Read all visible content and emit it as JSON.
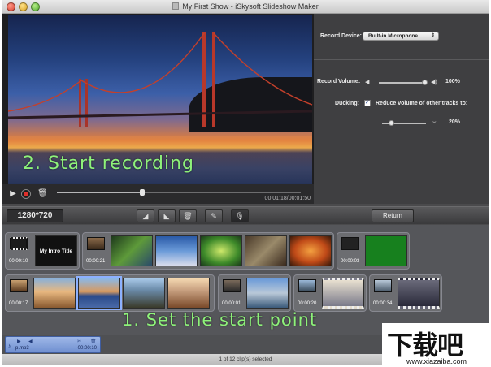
{
  "window": {
    "title": "My First Show - iSkysoft Slideshow Maker"
  },
  "preview": {
    "recording_hint": "2. Start recording",
    "timecode": "00:01:18/00:01:50",
    "playhead_fraction": 0.35
  },
  "panel": {
    "record_device_label": "Record Device:",
    "record_device_value": "Built-in Microphone",
    "record_volume_label": "Record Volume:",
    "record_volume_value": "100%",
    "record_volume_fraction": 1.0,
    "ducking_label": "Ducking:",
    "ducking_checked": true,
    "ducking_option": "Reduce volume of other tracks to:",
    "ducking_value": "20%",
    "ducking_fraction": 0.2
  },
  "toolbar": {
    "resolution": "1280*720",
    "return_label": "Return",
    "active_tool": "microphone-icon"
  },
  "storyboard": {
    "start_hint": "1. Set the start point",
    "groups": [
      {
        "lead_time": "00:00:10",
        "clips": [
          "My Intro Title"
        ]
      },
      {
        "lead_time": "00:00:21",
        "clips": [
          "",
          "",
          "",
          "",
          ""
        ]
      },
      {
        "lead_time": "00:00:03",
        "clips": [
          ""
        ]
      },
      {
        "lead_time": "00:00:17",
        "clips": [
          "",
          "",
          "",
          ""
        ]
      },
      {
        "lead_time": "00:00:01",
        "clips": [
          ""
        ]
      },
      {
        "lead_time": "00:00:20",
        "clips": [
          ""
        ]
      },
      {
        "lead_time": "00:00:34",
        "clips": [
          ""
        ]
      }
    ]
  },
  "audio": {
    "clip_name": "p.mp3",
    "clip_time": "00:00:10"
  },
  "status": {
    "text": "1 of 12 clip(s) selected"
  },
  "watermark": {
    "glyphs": "下载吧",
    "url": "www.xiazaiba.com"
  },
  "colors": {
    "hint_green": "#8ef27a",
    "selection": "#8db1ff",
    "record_red": "#e0312b"
  }
}
